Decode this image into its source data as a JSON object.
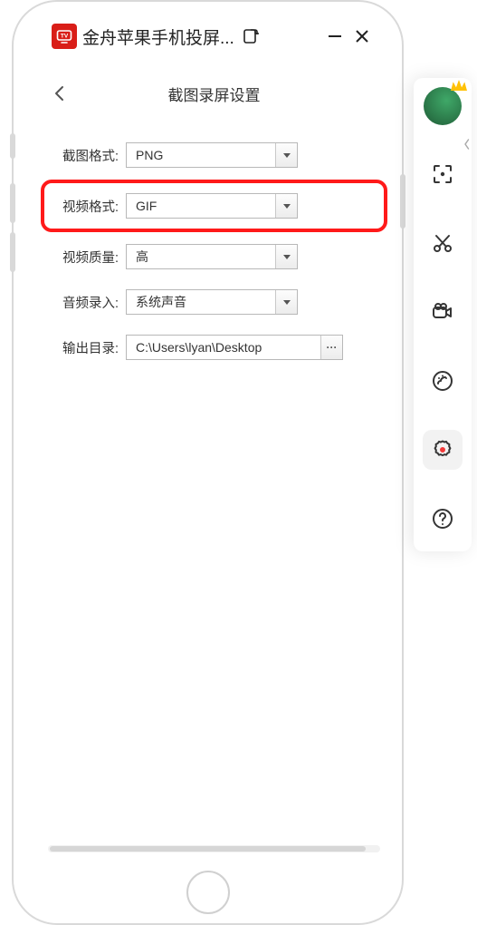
{
  "titlebar": {
    "app_name": "金舟苹果手机投屏...",
    "logo_text": "TV"
  },
  "page": {
    "title": "截图录屏设置"
  },
  "form": {
    "screenshot_format": {
      "label": "截图格式:",
      "value": "PNG"
    },
    "video_format": {
      "label": "视频格式:",
      "value": "GIF"
    },
    "video_quality": {
      "label": "视频质量:",
      "value": "高"
    },
    "audio_input": {
      "label": "音频录入:",
      "value": "系统声音"
    },
    "output_dir": {
      "label": "输出目录:",
      "value": "C:\\Users\\lyan\\Desktop"
    }
  },
  "rail": {
    "items": [
      {
        "name": "fullscreen",
        "active": false
      },
      {
        "name": "clip",
        "active": false
      },
      {
        "name": "record",
        "active": false
      },
      {
        "name": "brush",
        "active": false
      },
      {
        "name": "settings",
        "active": true
      },
      {
        "name": "help",
        "active": false
      }
    ]
  }
}
